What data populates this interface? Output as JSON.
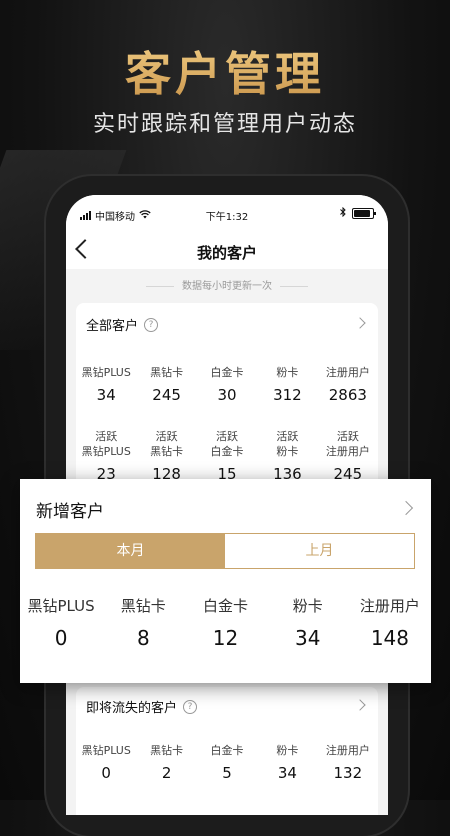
{
  "promo": {
    "headline": "客户管理",
    "subline": "实时跟踪和管理用户动态"
  },
  "status_bar": {
    "carrier": "中国移动",
    "time": "下午1:32"
  },
  "nav": {
    "title": "我的客户"
  },
  "update_note": "数据每小时更新一次",
  "all_customers": {
    "title": "全部客户",
    "help": "?",
    "totals": [
      {
        "label": "黑钻PLUS",
        "value": "34"
      },
      {
        "label": "黑钻卡",
        "value": "245"
      },
      {
        "label": "白金卡",
        "value": "30"
      },
      {
        "label": "粉卡",
        "value": "312"
      },
      {
        "label": "注册用户",
        "value": "2863"
      }
    ],
    "active": [
      {
        "label1": "活跃",
        "label2": "黑钻PLUS",
        "value": "23"
      },
      {
        "label1": "活跃",
        "label2": "黑钻卡",
        "value": "128"
      },
      {
        "label1": "活跃",
        "label2": "白金卡",
        "value": "15"
      },
      {
        "label1": "活跃",
        "label2": "粉卡",
        "value": "136"
      },
      {
        "label1": "活跃",
        "label2": "注册用户",
        "value": "245"
      }
    ]
  },
  "new_customers": {
    "title": "新增客户",
    "tabs": {
      "this_month": "本月",
      "last_month": "上月"
    },
    "stats": [
      {
        "label": "黑钻PLUS",
        "value": "0"
      },
      {
        "label": "黑钻卡",
        "value": "8"
      },
      {
        "label": "白金卡",
        "value": "12"
      },
      {
        "label": "粉卡",
        "value": "34"
      },
      {
        "label": "注册用户",
        "value": "148"
      }
    ]
  },
  "churn_customers": {
    "title": "即将流失的客户",
    "help": "?",
    "stats": [
      {
        "label": "黑钻PLUS",
        "value": "0"
      },
      {
        "label": "黑钻卡",
        "value": "2"
      },
      {
        "label": "白金卡",
        "value": "5"
      },
      {
        "label": "粉卡",
        "value": "34"
      },
      {
        "label": "注册用户",
        "value": "132"
      }
    ]
  },
  "colors": {
    "gold": "#c9a46b",
    "headline_gold": "#d7a85a",
    "background": "#121212"
  }
}
